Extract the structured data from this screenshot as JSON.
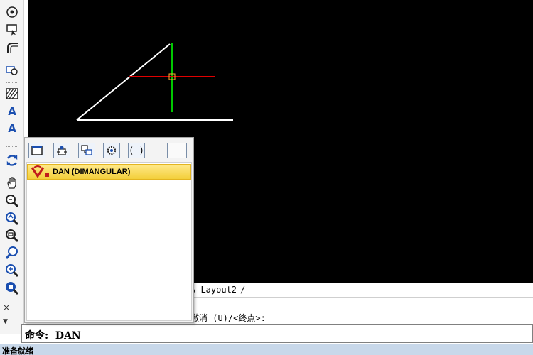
{
  "toolbar": {
    "icons": [
      "orbit-icon",
      "edit-select-icon",
      "fillet-icon",
      "table-icon",
      "hatch-icon",
      "multiline-text-icon",
      "text-icon",
      "regen-icon",
      "pan-icon",
      "zoom-realtime-icon",
      "zoom-previous-icon",
      "zoom-window-icon",
      "zoom-dynamic-icon",
      "zoom-in-icon",
      "zoom-extents-icon"
    ],
    "text_letter": "A"
  },
  "layout_tabs": {
    "visible_tab": "Layout2",
    "trailing_mark": "/"
  },
  "command": {
    "history_line": "撤消 (U)/<终点>:",
    "prompt_label": "命令:",
    "current_input": "DAN",
    "close_glyph": "×",
    "menu_glyph": "▼"
  },
  "status": {
    "text": "准备就绪"
  },
  "autocomplete": {
    "toolbar_buttons": [
      "window-icon",
      "insert-block-icon",
      "layers-icon",
      "settings-gear-icon",
      "brackets-icon",
      "blank-icon"
    ],
    "brackets_text": "( )",
    "selected_item": "DAN (DIMANGULAR)"
  },
  "colors": {
    "canvas": "#000000",
    "cursor_vertical": "#00c800",
    "cursor_horizontal": "#e00000",
    "geometry": "#ffffff",
    "selection": "#f3cf3a"
  }
}
